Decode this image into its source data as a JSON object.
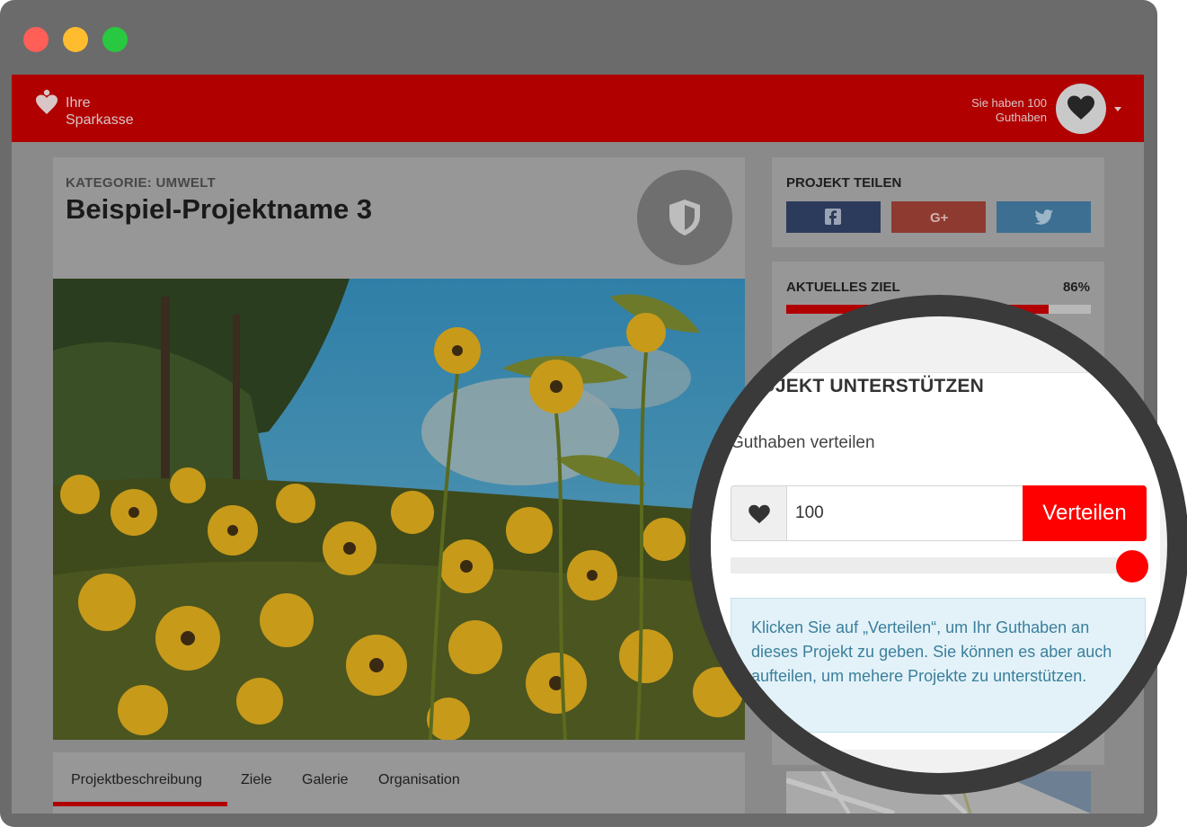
{
  "window": {
    "controls": [
      "close",
      "minimize",
      "maximize"
    ]
  },
  "header": {
    "logo_line1": "Ihre",
    "logo_line2": "Sparkasse",
    "logo_icon": "heart-person-icon",
    "credits_line1": "Sie haben 100",
    "credits_line2": "Guthaben",
    "avatar_icon": "heart-icon",
    "menu_icon": "chevron-down-icon",
    "color": "#b10000"
  },
  "project": {
    "category": "KATEGORIE: UMWELT",
    "title": "Beispiel-Projektname 3",
    "badge_icon": "shield-icon",
    "image": "yellow-flowers-meadow"
  },
  "tabs": [
    {
      "label": "Projektbeschreibung",
      "active": true
    },
    {
      "label": "Ziele",
      "active": false
    },
    {
      "label": "Galerie",
      "active": false
    },
    {
      "label": "Organisation",
      "active": false
    }
  ],
  "share": {
    "title": "PROJEKT TEILEN",
    "buttons": [
      {
        "icon": "facebook-icon",
        "color": "#3b5998"
      },
      {
        "icon": "google-plus-icon",
        "color": "#dd4b39"
      },
      {
        "icon": "twitter-icon",
        "color": "#55acee"
      }
    ]
  },
  "goal": {
    "title": "AKTUELLES ZIEL",
    "percent_label": "86%",
    "progress": 0.86
  },
  "support": {
    "title": "ROJEKT UNTERSTÜTZEN",
    "distribute_label": "Guthaben verteilen",
    "amount_value": "100",
    "button_label": "Verteilen",
    "slider_value": 1.0,
    "info_text": "Klicken Sie auf „Verteilen“, um Ihr Guthaben an dieses Projekt zu geben. Sie können es aber auch aufteilen, um mehere Projekte zu unterstützen.",
    "accent_color": "#ff0000"
  }
}
